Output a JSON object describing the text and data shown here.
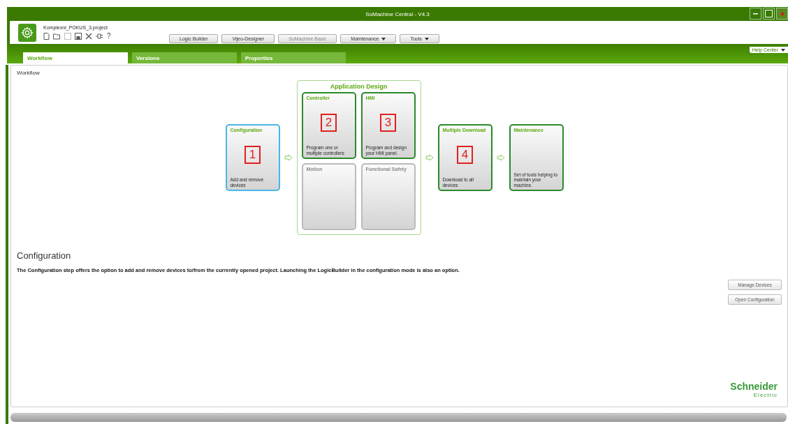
{
  "window": {
    "title": "SoMachine Central - V4.3"
  },
  "project": {
    "name": "Komplexni_POKUS_3.project"
  },
  "toolbar": [
    {
      "label": "Logic Builder",
      "disabled": false,
      "dropdown": false
    },
    {
      "label": "Vijeo-Designer",
      "disabled": false,
      "dropdown": false
    },
    {
      "label": "SoMachine Basic",
      "disabled": true,
      "dropdown": false
    },
    {
      "label": "Maintenance",
      "disabled": false,
      "dropdown": true
    },
    {
      "label": "Tools",
      "disabled": false,
      "dropdown": true
    }
  ],
  "quick_icons": [
    "?"
  ],
  "tabs": [
    {
      "label": "Workflow",
      "selected": true
    },
    {
      "label": "Versions",
      "selected": false
    },
    {
      "label": "Properties",
      "selected": false
    }
  ],
  "help": {
    "label": "Help Center"
  },
  "panel": {
    "title": "Workflow"
  },
  "workflow": [
    {
      "kind": "card",
      "title": "Configuration",
      "description": "Add and remove devices",
      "marker": "1",
      "selected": true,
      "disabled": false
    },
    {
      "kind": "group",
      "title": "Application Design",
      "cards": [
        {
          "title": "Controller",
          "description": "Program one or multiple controllers",
          "marker": "2",
          "selected": false,
          "disabled": false
        },
        {
          "title": "HMI",
          "description": "Program and design your HMI panel.",
          "marker": "3",
          "selected": false,
          "disabled": false
        },
        {
          "title": "Motion",
          "selected": false,
          "disabled": true
        },
        {
          "title": "Functional Safety",
          "selected": false,
          "disabled": true
        }
      ]
    },
    {
      "kind": "card",
      "title": "Multiple Download",
      "description": "Download to all devices",
      "marker": "4",
      "selected": false,
      "disabled": false
    },
    {
      "kind": "card",
      "title": "Maintenance",
      "description": "Set of tools helping to maintain your machine.",
      "selected": false,
      "disabled": false
    }
  ],
  "details": {
    "heading": "Configuration",
    "text": "The Configuration step offers the option to add and remove devices to/from the currently opened project. Launching the LogicBuilder in the configuration mode is also an option.",
    "buttons": [
      "Manage Devices",
      "Open Configuration"
    ]
  },
  "brand": {
    "name": "Schneider",
    "sub": "Electric"
  }
}
